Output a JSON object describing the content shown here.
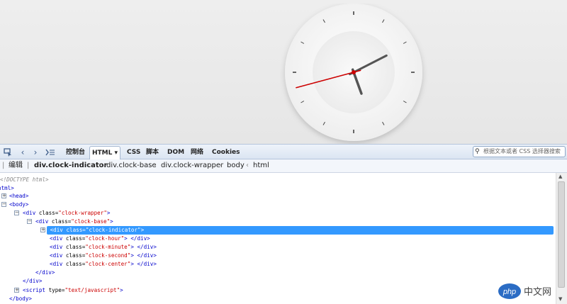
{
  "clock": {
    "face_color": "#f7f7f7",
    "hour_color": "#555555",
    "minute_color": "#555555",
    "second_color": "#cc0000",
    "tick_color": "#444444"
  },
  "toolbar": {
    "tabs": [
      {
        "label": "控制台",
        "active": false
      },
      {
        "label": "HTML",
        "active": true
      },
      {
        "label": "CSS",
        "active": false
      },
      {
        "label": "脚本",
        "active": false
      },
      {
        "label": "DOM",
        "active": false
      },
      {
        "label": "网络",
        "active": false
      },
      {
        "label": "Cookies",
        "active": false
      }
    ],
    "html_dropdown": "▾",
    "search_placeholder": "根据文本或者 CSS 选择器搜索"
  },
  "breadcrumb": {
    "edit_label": "编辑",
    "items": [
      "div.clock-indicator",
      "div.clock-base",
      "div.clock-wrapper",
      "body",
      "html"
    ]
  },
  "tree": {
    "doctype": "DOCTYPE html>",
    "html_open": "html>",
    "head": "<head>",
    "body_open": "<body>",
    "wrapper_tag": "<div class=\"",
    "wrapper_class": "clock-wrapper",
    "base_class": "clock-base",
    "indicator_class": "clock-indicator",
    "hour_class": "clock-hour",
    "minute_class": "clock-minute",
    "second_class": "clock-second",
    "center_class": "clock-center",
    "close_div": "</div>",
    "script_type": "text/javascript",
    "body_close": "</body>"
  },
  "watermark": {
    "logo": "php",
    "text": "中文网"
  }
}
